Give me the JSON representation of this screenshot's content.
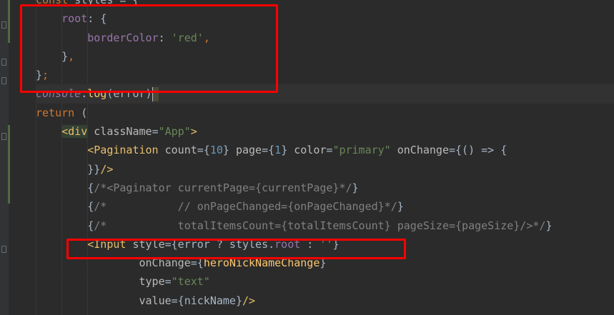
{
  "editor": {
    "lines": [
      {
        "indent": "",
        "tokens": [
          {
            "t": "kw",
            "v": "const "
          },
          {
            "t": "plain",
            "v": "styles = {"
          }
        ]
      },
      {
        "indent": "    ",
        "tokens": [
          {
            "t": "prop",
            "v": "root"
          },
          {
            "t": "plain",
            "v": ": {"
          }
        ]
      },
      {
        "indent": "        ",
        "tokens": [
          {
            "t": "prop",
            "v": "borderColor"
          },
          {
            "t": "plain",
            "v": ": "
          },
          {
            "t": "str",
            "v": "'red'"
          },
          {
            "t": "kw",
            "v": ","
          }
        ]
      },
      {
        "indent": "    ",
        "tokens": [
          {
            "t": "plain",
            "v": "}"
          },
          {
            "t": "kw",
            "v": ","
          }
        ]
      },
      {
        "indent": "",
        "tokens": [
          {
            "t": "plain",
            "v": "}"
          },
          {
            "t": "kw",
            "v": ";"
          }
        ]
      },
      {
        "indent": "",
        "tokens": [
          {
            "t": "glob",
            "v": "console"
          },
          {
            "t": "plain",
            "v": "."
          },
          {
            "t": "fn",
            "v": "log"
          },
          {
            "t": "plain",
            "v": "(error)"
          },
          {
            "t": "caret",
            "v": ""
          }
        ]
      },
      {
        "indent": "",
        "tokens": [
          {
            "t": "kw",
            "v": "return "
          },
          {
            "t": "plain",
            "v": "("
          }
        ]
      },
      {
        "indent": "    ",
        "tokens": [
          {
            "t": "tag-bg",
            "v": "<div"
          },
          {
            "t": "attr",
            "v": " className"
          },
          {
            "t": "plain",
            "v": "="
          },
          {
            "t": "str",
            "v": "\"App\""
          },
          {
            "t": "tag",
            "v": ">"
          }
        ]
      },
      {
        "indent": "        ",
        "tokens": [
          {
            "t": "tag",
            "v": "<Pagination"
          },
          {
            "t": "attr",
            "v": " count"
          },
          {
            "t": "plain",
            "v": "={"
          },
          {
            "t": "num",
            "v": "10"
          },
          {
            "t": "plain",
            "v": "} "
          },
          {
            "t": "attr",
            "v": "page"
          },
          {
            "t": "plain",
            "v": "={"
          },
          {
            "t": "num",
            "v": "1"
          },
          {
            "t": "plain",
            "v": "} "
          },
          {
            "t": "attr",
            "v": "color"
          },
          {
            "t": "plain",
            "v": "="
          },
          {
            "t": "str",
            "v": "\"primary\""
          },
          {
            "t": "plain",
            "v": " "
          },
          {
            "t": "attr",
            "v": "onChange"
          },
          {
            "t": "plain",
            "v": "={() => {"
          }
        ]
      },
      {
        "indent": "        ",
        "tokens": [
          {
            "t": "plain",
            "v": "}}"
          },
          {
            "t": "tag",
            "v": "/>"
          }
        ]
      },
      {
        "indent": "        ",
        "tokens": [
          {
            "t": "plain",
            "v": "{"
          },
          {
            "t": "cmt",
            "v": "/*<Paginator currentPage={currentPage}*/"
          },
          {
            "t": "plain",
            "v": "}"
          }
        ]
      },
      {
        "indent": "        ",
        "tokens": [
          {
            "t": "plain",
            "v": "{"
          },
          {
            "t": "cmt",
            "v": "/*           // onPageChanged={onPageChanged}*/"
          },
          {
            "t": "plain",
            "v": "}"
          }
        ]
      },
      {
        "indent": "        ",
        "tokens": [
          {
            "t": "plain",
            "v": "{"
          },
          {
            "t": "cmt",
            "v": "/*           totalItemsCount={totalItemsCount} pageSize={pageSize}/>*/"
          },
          {
            "t": "plain",
            "v": "}"
          }
        ]
      },
      {
        "indent": "        ",
        "tokens": [
          {
            "t": "tag",
            "v": "<Input"
          },
          {
            "t": "attr",
            "v": " style"
          },
          {
            "t": "plain",
            "v": "={error ? styles."
          },
          {
            "t": "prop",
            "v": "root"
          },
          {
            "t": "plain",
            "v": " : "
          },
          {
            "t": "str",
            "v": "''"
          },
          {
            "t": "plain",
            "v": "}"
          }
        ]
      },
      {
        "indent": "                ",
        "tokens": [
          {
            "t": "attr",
            "v": "onChange"
          },
          {
            "t": "plain",
            "v": "={"
          },
          {
            "t": "fn",
            "v": "heroNickNameChange"
          },
          {
            "t": "plain",
            "v": "}"
          }
        ]
      },
      {
        "indent": "                ",
        "tokens": [
          {
            "t": "attr",
            "v": "type"
          },
          {
            "t": "plain",
            "v": "="
          },
          {
            "t": "str",
            "v": "\"text\""
          }
        ]
      },
      {
        "indent": "                ",
        "tokens": [
          {
            "t": "attr",
            "v": "value"
          },
          {
            "t": "plain",
            "v": "={nickName}"
          },
          {
            "t": "tag",
            "v": "/>"
          }
        ]
      }
    ]
  },
  "colors": {
    "background": "#2b2b2b",
    "annotation_box": "#ff0000"
  }
}
